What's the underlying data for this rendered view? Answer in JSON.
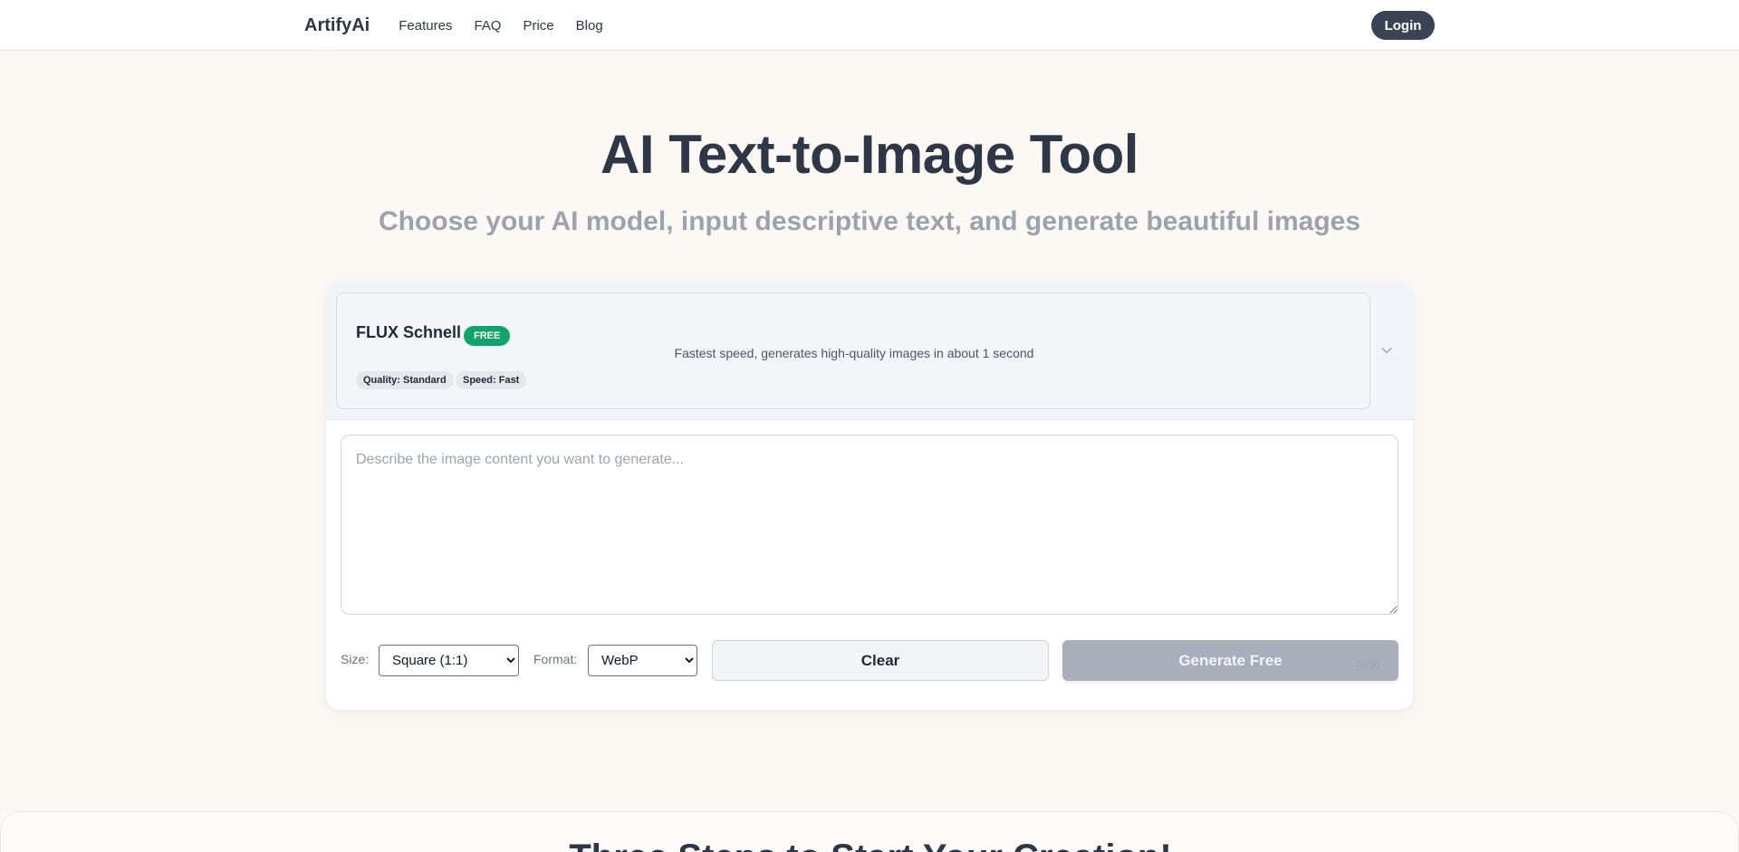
{
  "nav": {
    "brand": "ArtifyAi",
    "links": [
      "Features",
      "FAQ",
      "Price",
      "Blog"
    ],
    "login": "Login"
  },
  "hero": {
    "title": "AI Text-to-Image Tool",
    "subtitle": "Choose your AI model, input descriptive text, and generate beautiful images"
  },
  "model": {
    "name": "FLUX Schnell",
    "badge": "FREE",
    "description": "Fastest speed, generates high-quality images in about 1 second",
    "tags": [
      "Quality: Standard",
      "Speed: Fast"
    ],
    "badge_color": "#10a36b"
  },
  "prompt": {
    "placeholder": "Describe the image content you want to generate...",
    "counter": "0/200"
  },
  "controls": {
    "size_label": "Size:",
    "size_value": "Square (1:1)",
    "format_label": "Format:",
    "format_value": "WebP",
    "clear": "Clear",
    "generate": "Generate Free"
  },
  "steps": {
    "title": "Three Steps to Start Your Creation!"
  }
}
